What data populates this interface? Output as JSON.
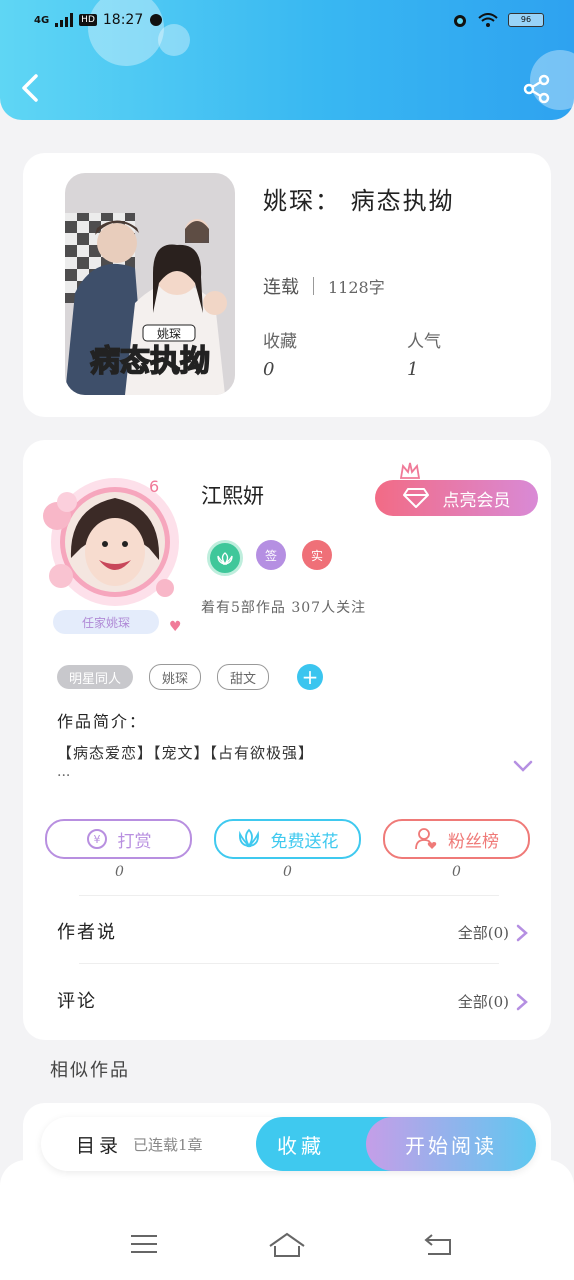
{
  "status_bar": {
    "network": "4G",
    "hd": "HD",
    "time": "18:27",
    "battery": "96"
  },
  "header": {
    "back_icon": "chevron-left-icon",
    "share_icon": "share-icon"
  },
  "book": {
    "title": "姚琛： 病态执拗",
    "status": "连载",
    "word_count": "1128字",
    "favorites_label": "收藏",
    "favorites_value": "0",
    "popularity_label": "人气",
    "popularity_value": "1",
    "cover_text": "病态执拗",
    "cover_tag": "姚琛"
  },
  "author": {
    "name": "江熙妍",
    "level": "6",
    "frame_caption": "任家姚琛",
    "vip_button": "点亮会员",
    "badges": [
      "签",
      "实"
    ],
    "stats": "着有5部作品 307人关注"
  },
  "tags": [
    "明星同人",
    "姚琛",
    "甜文"
  ],
  "intro": {
    "label": "作品简介：",
    "text": "【病态爱恋】【宠文】【占有欲极强】",
    "more": "..."
  },
  "actions": [
    {
      "label": "打赏",
      "count": "0",
      "color": "#b88fe0"
    },
    {
      "label": "免费送花",
      "count": "0",
      "color": "#3fc9ef"
    },
    {
      "label": "粉丝榜",
      "count": "0",
      "color": "#ef7a78"
    }
  ],
  "author_says": {
    "label": "作者说",
    "right": "全部(0)"
  },
  "comments": {
    "label": "评论",
    "right": "全部(0)"
  },
  "similar": {
    "label": "相似作品"
  },
  "bottom_bar": {
    "toc_label": "目录",
    "toc_status": "已连载1章",
    "favorite_button": "收藏",
    "read_button": "开始阅读"
  },
  "colors": {
    "accent": "#3fc9ef",
    "header_start": "#5fd6f4",
    "header_end": "#2ea2f0",
    "vip_start": "#f26b85"
  }
}
